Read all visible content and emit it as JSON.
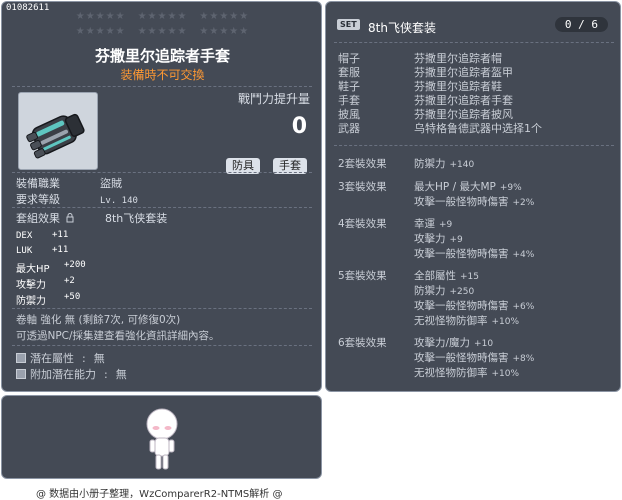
{
  "item": {
    "id": "01082611",
    "name": "芬撒里尔追踪者手套",
    "untradeable": "装備時不可交換",
    "power_label": "戰鬥力提升量",
    "power_value": "0",
    "tags": [
      "防具",
      "手套"
    ],
    "job_label": "裝備職業",
    "job_value": "盜賊",
    "level_label": "要求等級",
    "level_value": "Lv. 140",
    "set_label": "套組效果",
    "set_name": "8th飞侠套装",
    "stats": [
      {
        "name": "DEX",
        "value": "+11"
      },
      {
        "name": "LUK",
        "value": "+11"
      },
      {
        "name": "最大HP",
        "value": "+200"
      },
      {
        "name": "攻擊力",
        "value": "+2"
      },
      {
        "name": "防禦力",
        "value": "+50"
      }
    ],
    "scroll_text": "卷軸 強化 無 (剩餘7次, 可修復0次)",
    "info_text": "可透過NPC/採集建查看強化資訊詳細內容。",
    "potential_label": "潛在屬性",
    "potential_value": "無",
    "add_potential_label": "附加潛在能力",
    "add_potential_value": "無"
  },
  "set": {
    "badge": "SET",
    "title": "8th飞侠套装",
    "count": "0 / 6",
    "items": [
      {
        "slot": "帽子",
        "name": "芬撒里尔追踪者帽"
      },
      {
        "slot": "套服",
        "name": "芬撒里尔追踪者盔甲"
      },
      {
        "slot": "鞋子",
        "name": "芬撒里尔追踪者鞋"
      },
      {
        "slot": "手套",
        "name": "芬撒里尔追踪者手套"
      },
      {
        "slot": "披風",
        "name": "芬撒里尔追踪者披风"
      },
      {
        "slot": "武器",
        "name": "乌特格鲁德武器中选择1个"
      }
    ],
    "effects": [
      {
        "title": "2套裝效果",
        "lines": [
          {
            "text": "防禦力",
            "num": "+140"
          }
        ]
      },
      {
        "title": "3套裝效果",
        "lines": [
          {
            "text": "最大HP / 最大MP",
            "num": "+9%"
          },
          {
            "text": "攻擊一般怪物時傷害",
            "num": "+2%"
          }
        ]
      },
      {
        "title": "4套裝效果",
        "lines": [
          {
            "text": "幸運",
            "num": "+9"
          },
          {
            "text": "攻擊力",
            "num": "+9"
          },
          {
            "text": "攻擊一般怪物時傷害",
            "num": "+4%"
          }
        ]
      },
      {
        "title": "5套裝效果",
        "lines": [
          {
            "text": "全部屬性",
            "num": "+15"
          },
          {
            "text": "防禦力",
            "num": "+250"
          },
          {
            "text": "攻擊一般怪物時傷害",
            "num": "+6%"
          },
          {
            "text": "无视怪物防御率",
            "num": "+10%"
          }
        ]
      },
      {
        "title": "6套裝效果",
        "lines": [
          {
            "text": "攻擊力/魔力",
            "num": "+10"
          },
          {
            "text": "攻擊一般怪物時傷害",
            "num": "+8%"
          },
          {
            "text": "无视怪物防御率",
            "num": "+10%"
          }
        ]
      }
    ]
  },
  "footer": "@ 数据由小册子整理，WzComparerR2-NTMS解析 @",
  "icons": {
    "glove": "glove-icon",
    "lock": "lock-icon",
    "avatar": "character-avatar"
  }
}
